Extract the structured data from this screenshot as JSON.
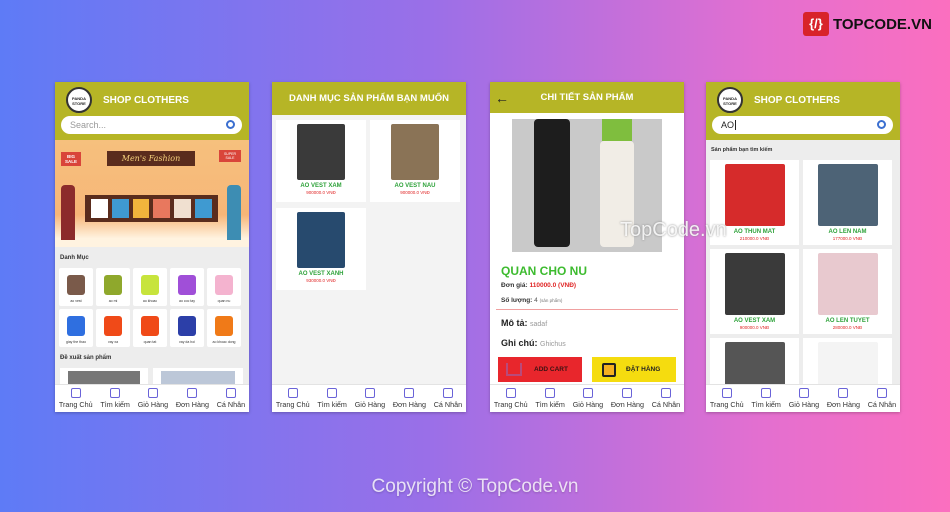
{
  "watermark": {
    "brand": "TOPCODE.VN",
    "center": "TopCode.vn",
    "copyright": "Copyright © TopCode.vn"
  },
  "colors": {
    "header": "#b6b526",
    "price": "#e02626",
    "name": "#2ea23a",
    "add_cart": "#e8262c",
    "order": "#f5dc0f"
  },
  "nav": [
    {
      "label": "Trang Chủ",
      "icon": "home-icon"
    },
    {
      "label": "Tìm kiếm",
      "icon": "search-chat-icon"
    },
    {
      "label": "Giỏ Hàng",
      "icon": "cart-icon"
    },
    {
      "label": "Đơn Hàng",
      "icon": "clipboard-icon"
    },
    {
      "label": "Cá Nhân",
      "icon": "user-icon"
    }
  ],
  "home": {
    "logo": "PANDA STORE",
    "title": "SHOP CLOTHERS",
    "search_placeholder": "Search...",
    "banner": "Men's Fashion",
    "banner_tag_left": "BIG SALE",
    "banner_tag_right": "SUPER SALE",
    "category_heading": "Danh Mục",
    "categories": [
      "ao vest",
      "ao mi",
      "ao khoac",
      "ao coc tay",
      "quan nu",
      "giay the thao",
      "vay xa",
      "quan tat",
      "vay da hoi",
      "ao khoac dong"
    ],
    "suggest_heading": "Đề xuất sản phẩm"
  },
  "category": {
    "title": "DANH MỤC SẢN PHẨM BẠN MUỐN",
    "products": [
      {
        "name": "AO VEST XAM",
        "price": "900000.0 VNĐ",
        "color": "#3a3a3a"
      },
      {
        "name": "AO VEST NAU",
        "price": "900000.0 VNĐ",
        "color": "#8a7356"
      },
      {
        "name": "AO VEST XANH",
        "price": "930000.0 VNĐ",
        "color": "#274a6e"
      }
    ]
  },
  "detail": {
    "title": "CHI TIẾT SẢN PHẨM",
    "name": "QUAN CHO NU",
    "price_label": "Đơn giá:",
    "price": "110000.0  (VNĐ)",
    "qty_label": "Số lượng:",
    "qty": "4",
    "qty_unit": "(sản phẩm)",
    "desc_label": "Mô tả:",
    "desc": "sadaf",
    "note_label": "Ghi chú:",
    "note": "Ghichus",
    "add_cart": "ADD CART",
    "order": "ĐẶT HÀNG"
  },
  "search": {
    "logo": "PANDA STORE",
    "title": "SHOP CLOTHERS",
    "query": "AO",
    "heading": "Sản phẩm bạn tìm kiếm",
    "products": [
      {
        "name": "AO THUN MAT",
        "price": "210000.0 VNĐ",
        "color": "#d62b2b"
      },
      {
        "name": "AO LEN NAM",
        "price": "177000.0 VNĐ",
        "color": "#4d6376"
      },
      {
        "name": "AO VEST XAM",
        "price": "900000.0 VNĐ",
        "color": "#3a3a3a"
      },
      {
        "name": "AO LEN TUYET",
        "price": "280000.0 VNĐ",
        "color": "#e8c9cf"
      },
      {
        "name": "",
        "price": "",
        "color": "#555"
      },
      {
        "name": "",
        "price": "",
        "color": "#f4f4f4"
      }
    ]
  }
}
